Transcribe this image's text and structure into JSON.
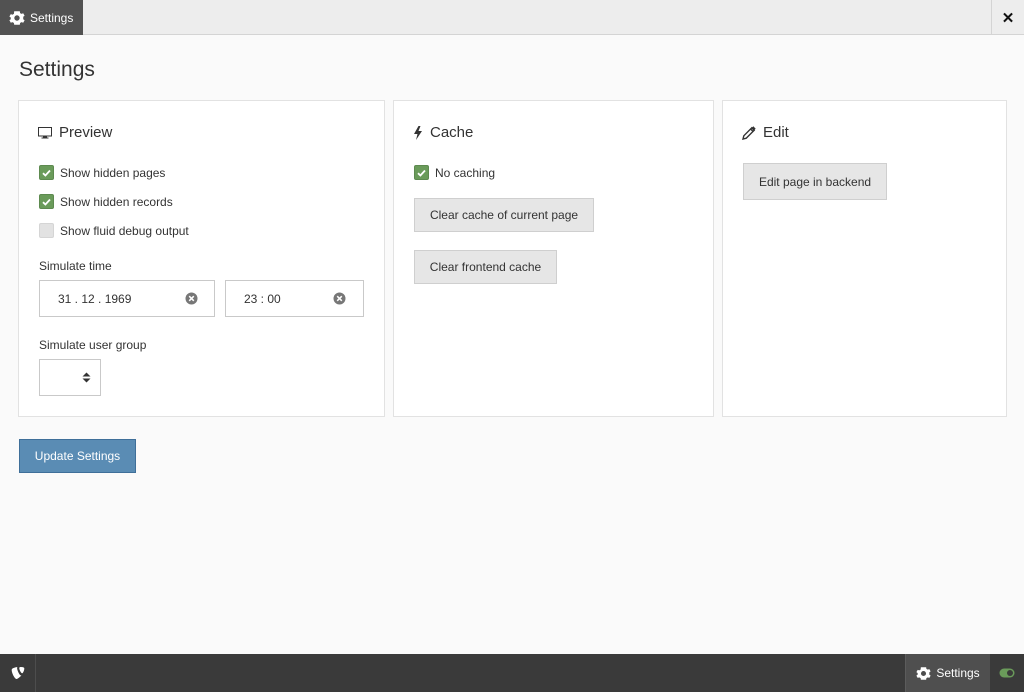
{
  "topbar": {
    "tab_label": "Settings",
    "close_symbol": "✕"
  },
  "page": {
    "title": "Settings"
  },
  "preview": {
    "title": "Preview",
    "show_hidden_pages": {
      "label": "Show hidden pages",
      "checked": true
    },
    "show_hidden_records": {
      "label": "Show hidden records",
      "checked": true
    },
    "show_fluid_debug": {
      "label": "Show fluid debug output",
      "checked": false
    },
    "simulate_time_label": "Simulate time",
    "date_value": "31 . 12 . 1969",
    "time_value": "23 : 00",
    "simulate_user_group_label": "Simulate user group",
    "user_group_value": ""
  },
  "cache": {
    "title": "Cache",
    "no_caching": {
      "label": "No caching",
      "checked": true
    },
    "clear_current_label": "Clear cache of current page",
    "clear_frontend_label": "Clear frontend cache"
  },
  "edit": {
    "title": "Edit",
    "edit_backend_label": "Edit page in backend"
  },
  "actions": {
    "update_label": "Update Settings"
  },
  "bottombar": {
    "tab_label": "Settings"
  },
  "colors": {
    "accent": "#5a8cb4",
    "check": "#6a9b5a",
    "toggle": "#6a9b5a"
  }
}
